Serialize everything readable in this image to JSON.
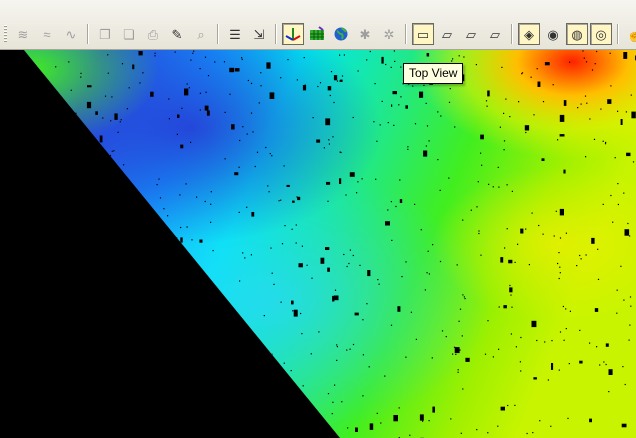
{
  "toolbar": {
    "buttons": [
      {
        "name": "surface-tool-1-icon",
        "glyph": "≋"
      },
      {
        "name": "surface-tool-2-icon",
        "glyph": "≈"
      },
      {
        "name": "surface-tool-3-icon",
        "glyph": "∿"
      },
      {
        "name": "copy-object-icon",
        "glyph": "❐"
      },
      {
        "name": "paste-object-icon",
        "glyph": "❏"
      },
      {
        "name": "print-icon",
        "glyph": "⎙"
      },
      {
        "name": "pick-tool-icon",
        "glyph": "✎"
      },
      {
        "name": "print-preview-icon",
        "glyph": "⌕"
      },
      {
        "name": "layers-icon",
        "glyph": "☰"
      },
      {
        "name": "select-layer-icon",
        "glyph": "⇲"
      },
      {
        "name": "axes-icon",
        "glyph": "✚"
      },
      {
        "name": "grid-surface-icon",
        "glyph": "▦"
      },
      {
        "name": "globe-icon",
        "glyph": "●"
      },
      {
        "name": "sparkle-icon",
        "glyph": "✱"
      },
      {
        "name": "sparkle-layer-icon",
        "glyph": "✲"
      },
      {
        "name": "top-view-icon",
        "glyph": "▭"
      },
      {
        "name": "front-view-icon",
        "glyph": "▱"
      },
      {
        "name": "side-view-icon",
        "glyph": "▱"
      },
      {
        "name": "perspective-view-icon",
        "glyph": "▱"
      },
      {
        "name": "shading-mode-1-icon",
        "glyph": "◈"
      },
      {
        "name": "shading-mode-2-icon",
        "glyph": "◉"
      },
      {
        "name": "shading-mode-3-icon",
        "glyph": "◍"
      },
      {
        "name": "shading-mode-4-icon",
        "glyph": "◎"
      },
      {
        "name": "pan-hand-icon",
        "glyph": "☝"
      }
    ]
  },
  "tooltip": {
    "text": "Top View"
  },
  "colors": {
    "toolbar_bg": "#ece9d8",
    "tooltip_bg": "#ffffe1",
    "viewport_bg": "#000000",
    "dem_low": "#2a3cd8",
    "dem_mid": "#00e0ff",
    "dem_high": "#ffe000",
    "dem_peak": "#ff2000"
  }
}
